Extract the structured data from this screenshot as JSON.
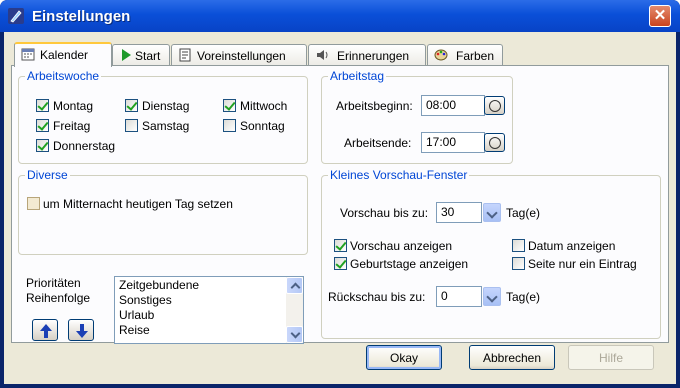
{
  "window": {
    "title": "Einstellungen",
    "close_label": "✕"
  },
  "tabs": [
    {
      "label": "Kalender",
      "icon": "calendar-icon",
      "active": true
    },
    {
      "label": "Start",
      "icon": "play-icon"
    },
    {
      "label": "Voreinstellungen",
      "icon": "document-icon"
    },
    {
      "label": "Erinnerungen",
      "icon": "speaker-icon"
    },
    {
      "label": "Farben",
      "icon": "palette-icon"
    }
  ],
  "arbeitswoche": {
    "title": "Arbeitswoche",
    "days": [
      {
        "label": "Montag",
        "checked": true
      },
      {
        "label": "Dienstag",
        "checked": true
      },
      {
        "label": "Mittwoch",
        "checked": true
      },
      {
        "label": "Freitag",
        "checked": true
      },
      {
        "label": "Samstag",
        "checked": false
      },
      {
        "label": "Sonntag",
        "checked": false
      },
      {
        "label": "Donnerstag",
        "checked": true
      }
    ]
  },
  "arbeitstag": {
    "title": "Arbeitstag",
    "beginn_label": "Arbeitsbeginn:",
    "beginn_value": "08:00",
    "ende_label": "Arbeitsende:",
    "ende_value": "17:00"
  },
  "diverse": {
    "title": "Diverse",
    "mitternacht_label": "um Mitternacht heutigen Tag setzen",
    "mitternacht_checked": false
  },
  "prioritaeten": {
    "label_line1": "Prioritäten",
    "label_line2": "Reihenfolge",
    "items": [
      "Zeitgebundene",
      "Sonstiges",
      "Urlaub",
      "Reise"
    ]
  },
  "vorschau": {
    "title": "Kleines Vorschau-Fenster",
    "bis_label": "Vorschau bis zu:",
    "bis_value": "30",
    "bis_unit": "Tag(e)",
    "anzeigen_label": "Vorschau anzeigen",
    "anzeigen_checked": true,
    "datum_label": "Datum anzeigen",
    "datum_checked": false,
    "geburtstage_label": "Geburtstage anzeigen",
    "geburtstage_checked": true,
    "seite_label": "Seite nur ein Eintrag",
    "seite_checked": false,
    "rueck_label": "Rückschau bis zu:",
    "rueck_value": "0",
    "rueck_unit": "Tag(e)"
  },
  "buttons": {
    "ok": "Okay",
    "cancel": "Abbrechen",
    "help": "Hilfe"
  }
}
